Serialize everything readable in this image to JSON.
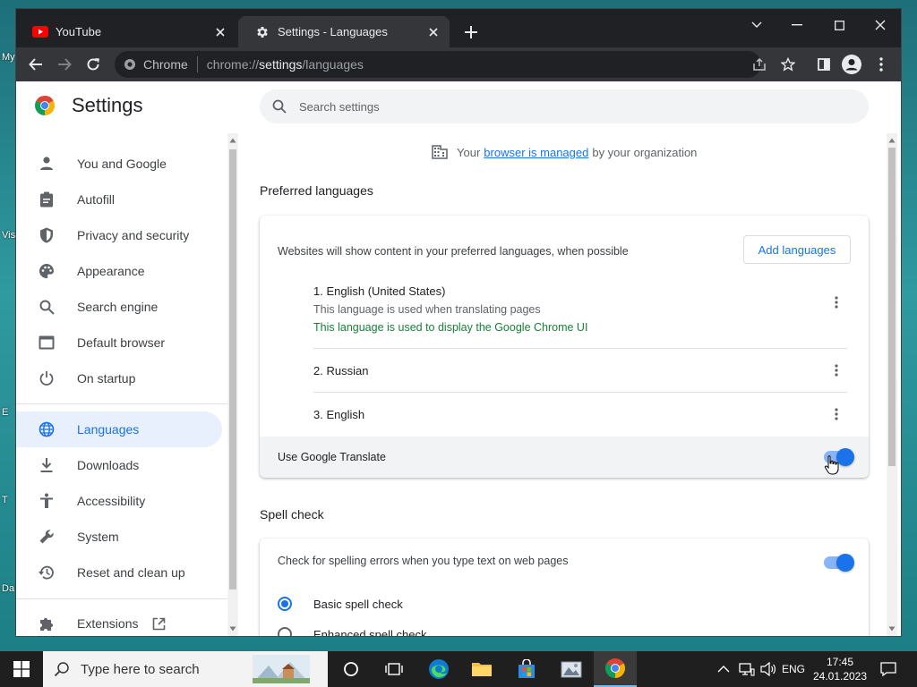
{
  "desktop": {
    "icon_labels": [
      "My",
      "Vis",
      "E",
      "T",
      "Da"
    ]
  },
  "browser": {
    "tabs": [
      {
        "title": "YouTube",
        "icon": "youtube-icon",
        "active": false
      },
      {
        "title": "Settings - Languages",
        "icon": "gear-icon",
        "active": true
      }
    ],
    "omnibox": {
      "chip": "Chrome",
      "url_scheme": "chrome://",
      "url_host": "settings",
      "url_path": "/languages"
    }
  },
  "settings": {
    "title": "Settings",
    "search_placeholder": "Search settings",
    "nav": [
      {
        "label": "You and Google",
        "icon": "person-icon"
      },
      {
        "label": "Autofill",
        "icon": "clipboard-icon"
      },
      {
        "label": "Privacy and security",
        "icon": "shield-icon"
      },
      {
        "label": "Appearance",
        "icon": "palette-icon"
      },
      {
        "label": "Search engine",
        "icon": "search-icon"
      },
      {
        "label": "Default browser",
        "icon": "browser-window-icon"
      },
      {
        "label": "On startup",
        "icon": "power-icon"
      },
      {
        "label": "Languages",
        "icon": "globe-icon",
        "selected": true
      },
      {
        "label": "Downloads",
        "icon": "download-icon"
      },
      {
        "label": "Accessibility",
        "icon": "accessibility-icon"
      },
      {
        "label": "System",
        "icon": "wrench-icon"
      },
      {
        "label": "Reset and clean up",
        "icon": "history-icon"
      },
      {
        "label": "Extensions",
        "icon": "puzzle-icon"
      }
    ],
    "managed": {
      "prefix": "Your",
      "link": "browser is managed",
      "suffix": "by your organization"
    },
    "preferred": {
      "heading": "Preferred languages",
      "description": "Websites will show content in your preferred languages, when possible",
      "add_button": "Add languages",
      "languages": [
        {
          "name": "1. English (United States)",
          "sub": "This language is used when translating pages",
          "ui": "This language is used to display the Google Chrome UI"
        },
        {
          "name": "2. Russian"
        },
        {
          "name": "3. English"
        }
      ],
      "translate_label": "Use Google Translate",
      "translate_on": true
    },
    "spell": {
      "heading": "Spell check",
      "description": "Check for spelling errors when you type text on web pages",
      "enabled": true,
      "options": [
        {
          "label": "Basic spell check",
          "checked": true
        },
        {
          "label": "Enhanced spell check",
          "checked": false
        }
      ]
    }
  },
  "taskbar": {
    "search_placeholder": "Type here to search",
    "language": "ENG",
    "time": "17:45",
    "date": "24.01.2023"
  }
}
